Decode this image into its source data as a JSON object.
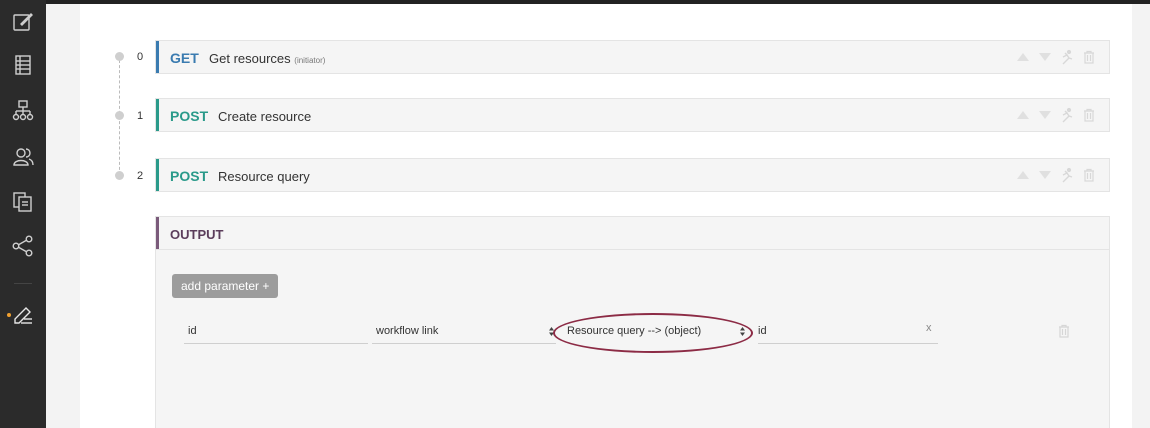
{
  "sidebar": {
    "items": [
      {
        "icon": "edit-icon"
      },
      {
        "icon": "list-icon"
      },
      {
        "icon": "hierarchy-icon"
      },
      {
        "icon": "users-icon"
      },
      {
        "icon": "documents-icon"
      },
      {
        "icon": "share-icon"
      },
      {
        "icon": "workflow-edit-icon",
        "active": true
      }
    ]
  },
  "steps": [
    {
      "index": "0",
      "method": "GET",
      "title": "Get resources",
      "note": "(initiator)",
      "color": "#3a7bb0"
    },
    {
      "index": "1",
      "method": "POST",
      "title": "Create resource",
      "note": "",
      "color": "#2a9a8a"
    },
    {
      "index": "2",
      "method": "POST",
      "title": "Resource query",
      "note": "",
      "color": "#2a9a8a"
    }
  ],
  "output": {
    "label": "OUTPUT",
    "add_button": "add parameter +",
    "param": {
      "name": "id",
      "source": "workflow link",
      "link": "Resource query --> (object)",
      "field": "id",
      "clear": "x"
    }
  },
  "colors": {
    "get": "#3a7bb0",
    "post": "#2a9a8a",
    "output": "#7a5a7a",
    "highlight": "#8c2b45"
  }
}
